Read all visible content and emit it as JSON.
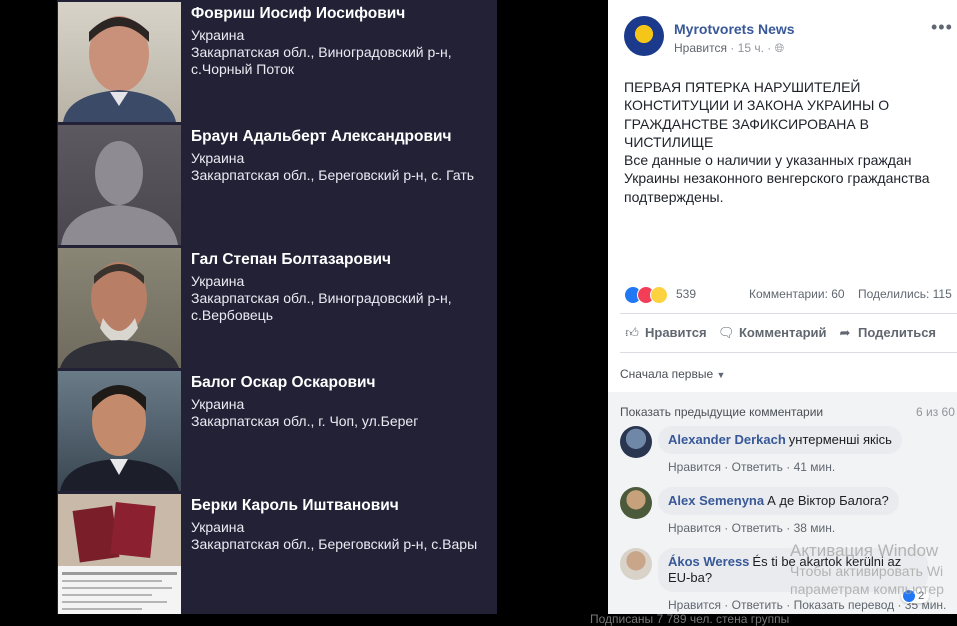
{
  "people": [
    {
      "name": "Фовриш Иосиф Иосифович",
      "country": "Украина",
      "address": "Закарпатская обл., Виноградовский р-н, с.Чорный Поток"
    },
    {
      "name": "Браун Адальберт Александрович",
      "country": "Украина",
      "address": "Закарпатская обл., Береговский р-н, с. Гать"
    },
    {
      "name": "Гал Степан Болтазарович",
      "country": "Украина",
      "address": "Закарпатская обл., Виноградовский р-н, с.Вербовець"
    },
    {
      "name": "Балог Оскар Оскарович",
      "country": "Украина",
      "address": "Закарпатская обл., г. Чоп, ул.Берег"
    },
    {
      "name": "Берки Кароль Иштванович",
      "country": "Украина",
      "address": "Закарпатская обл., Береговский р-н, с.Вары"
    }
  ],
  "post": {
    "page_name": "Myrotvorets News",
    "like_word": "Нравится",
    "time": "15 ч.",
    "text_line1": "ПЕРВАЯ ПЯТЕРКА НАРУШИТЕЛЕЙ КОНСТИТУЦИИ И ЗАКОНА УКРАИНЫ О ГРАЖДАНСТВЕ ЗАФИКСИРОВАНА В ЧИСТИЛИЩЕ",
    "text_line2": "Все данные о наличии у указанных граждан Украины незаконного венгерского гражданства подтверждены.",
    "reactions_count": "539",
    "comments_count": "Комментарии: 60",
    "shares_count": "Поделились: 115",
    "action_like": "Нравится",
    "action_comment": "Комментарий",
    "action_share": "Поделиться",
    "sort_label": "Сначала первые",
    "prev_comments": "Показать предыдущие комментарии",
    "prev_count": "6 из 60"
  },
  "comments": [
    {
      "author": "Alexander Derkach",
      "text": "унтерменші якісь",
      "like": "Нравится",
      "reply": "Ответить",
      "time": "41 мин."
    },
    {
      "author": "Alex Semenyna",
      "text": "А де Віктор Балога?",
      "like": "Нравится",
      "reply": "Ответить",
      "time": "38 мин."
    },
    {
      "author": "Ákos Weress",
      "text": "És ti be akartok kerülni az",
      "text2": "EU-ba?",
      "like": "Нравится",
      "reply": "Ответить",
      "translate": "Показать перевод",
      "time": "35 мин.",
      "react": "2"
    }
  ],
  "watermark": {
    "line1": "Активация Window",
    "line2": "Чтобы активировать Wi",
    "line3": "параметрам компьютер"
  },
  "footer": {
    "text": "Подписаны 7 789 чел. стена группы"
  }
}
